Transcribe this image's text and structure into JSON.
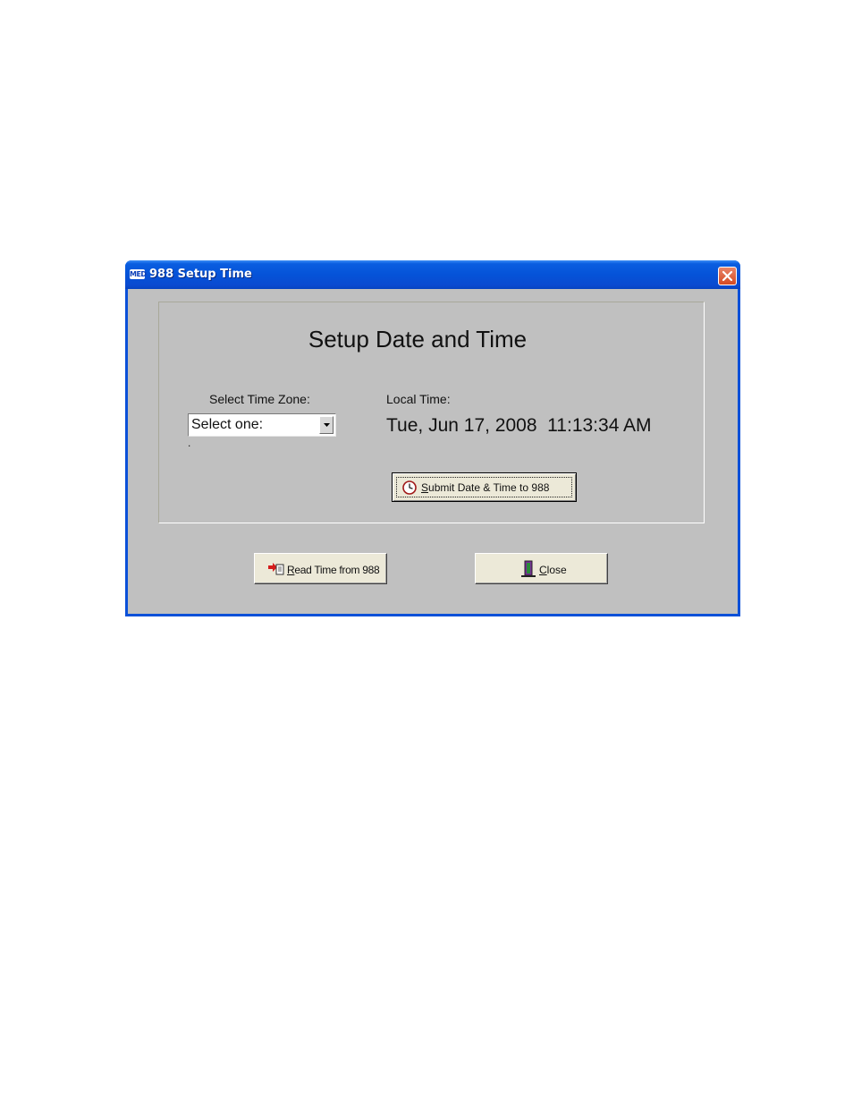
{
  "window": {
    "title": "988 Setup Time",
    "app_logo": "MED"
  },
  "main": {
    "heading": "Setup Date and Time",
    "time_zone_label": "Select Time Zone:",
    "time_zone_value": "Select one:",
    "time_zone_note": ".",
    "local_time_label": "Local Time:",
    "local_time_value": "Tue, Jun 17, 2008  11:13:34 AM"
  },
  "buttons": {
    "submit": {
      "hotkey": "S",
      "rest": "ubmit Date & Time to 988",
      "icon": "clock-icon"
    },
    "read": {
      "hotkey": "R",
      "rest": "ead Time from 988",
      "icon": "read-device-icon"
    },
    "close": {
      "hotkey": "C",
      "rest": "lose",
      "icon": "door-exit-icon"
    }
  },
  "colors": {
    "title_bar": "#0553d8",
    "client_bg": "#c0c0c0",
    "close_button": "#d44a22"
  }
}
